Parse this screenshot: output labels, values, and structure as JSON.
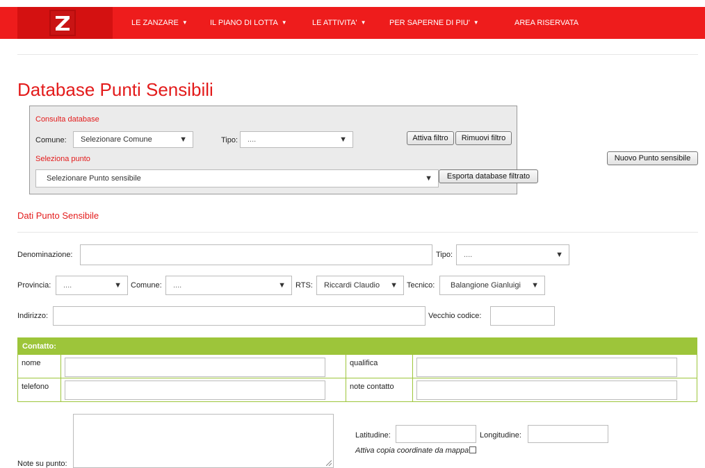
{
  "nav": {
    "logo_letter": "Z",
    "items": [
      {
        "label": "LE ZANZARE",
        "dropdown": true
      },
      {
        "label": "IL PIANO DI LOTTA",
        "dropdown": true
      },
      {
        "label": "LE ATTIVITA'",
        "dropdown": true
      },
      {
        "label": "PER SAPERNE DI PIU'",
        "dropdown": true
      },
      {
        "label": "AREA RISERVATA",
        "dropdown": false
      }
    ]
  },
  "page_title": "Database Punti Sensibili",
  "consulta": {
    "heading": "Consulta database",
    "comune_label": "Comune:",
    "comune_value": "Selezionare Comune",
    "tipo_label": "Tipo:",
    "tipo_value": "....",
    "attiva_filtro": "Attiva filtro",
    "rimuovi_filtro": "Rimuovi filtro",
    "seleziona_heading": "Seleziona punto",
    "punto_value": "Selezionare Punto sensibile",
    "esporta": "Esporta database filtrato"
  },
  "nuovo_punto": "Nuovo Punto sensibile",
  "dati": {
    "heading": "Dati Punto Sensibile",
    "denominazione_label": "Denominazione:",
    "tipo_label": "Tipo:",
    "tipo_value": "....",
    "provincia_label": "Provincia:",
    "provincia_value": "....",
    "comune_label": "Comune:",
    "comune_value": "....",
    "rts_label": "RTS:",
    "rts_value": "Riccardi Claudio",
    "tecnico_label": "Tecnico:",
    "tecnico_value": "Balangione Gianluigi",
    "indirizzo_label": "Indirizzo:",
    "vecchio_codice_label": "Vecchio codice:"
  },
  "contatto": {
    "title": "Contatto:",
    "nome": "nome",
    "qualifica": "qualifica",
    "telefono": "telefono",
    "note_contatto": "note contatto"
  },
  "note": {
    "note_label": "Note su punto:",
    "latitudine_label": "Latitudine:",
    "longitudine_label": "Longitudine:",
    "copia_label": "Attiva copia coordinate da mappa"
  },
  "colors": {
    "brand_red": "#ee1c1c",
    "title_red": "#e31b1b",
    "contatto_green": "#9dc53a"
  }
}
